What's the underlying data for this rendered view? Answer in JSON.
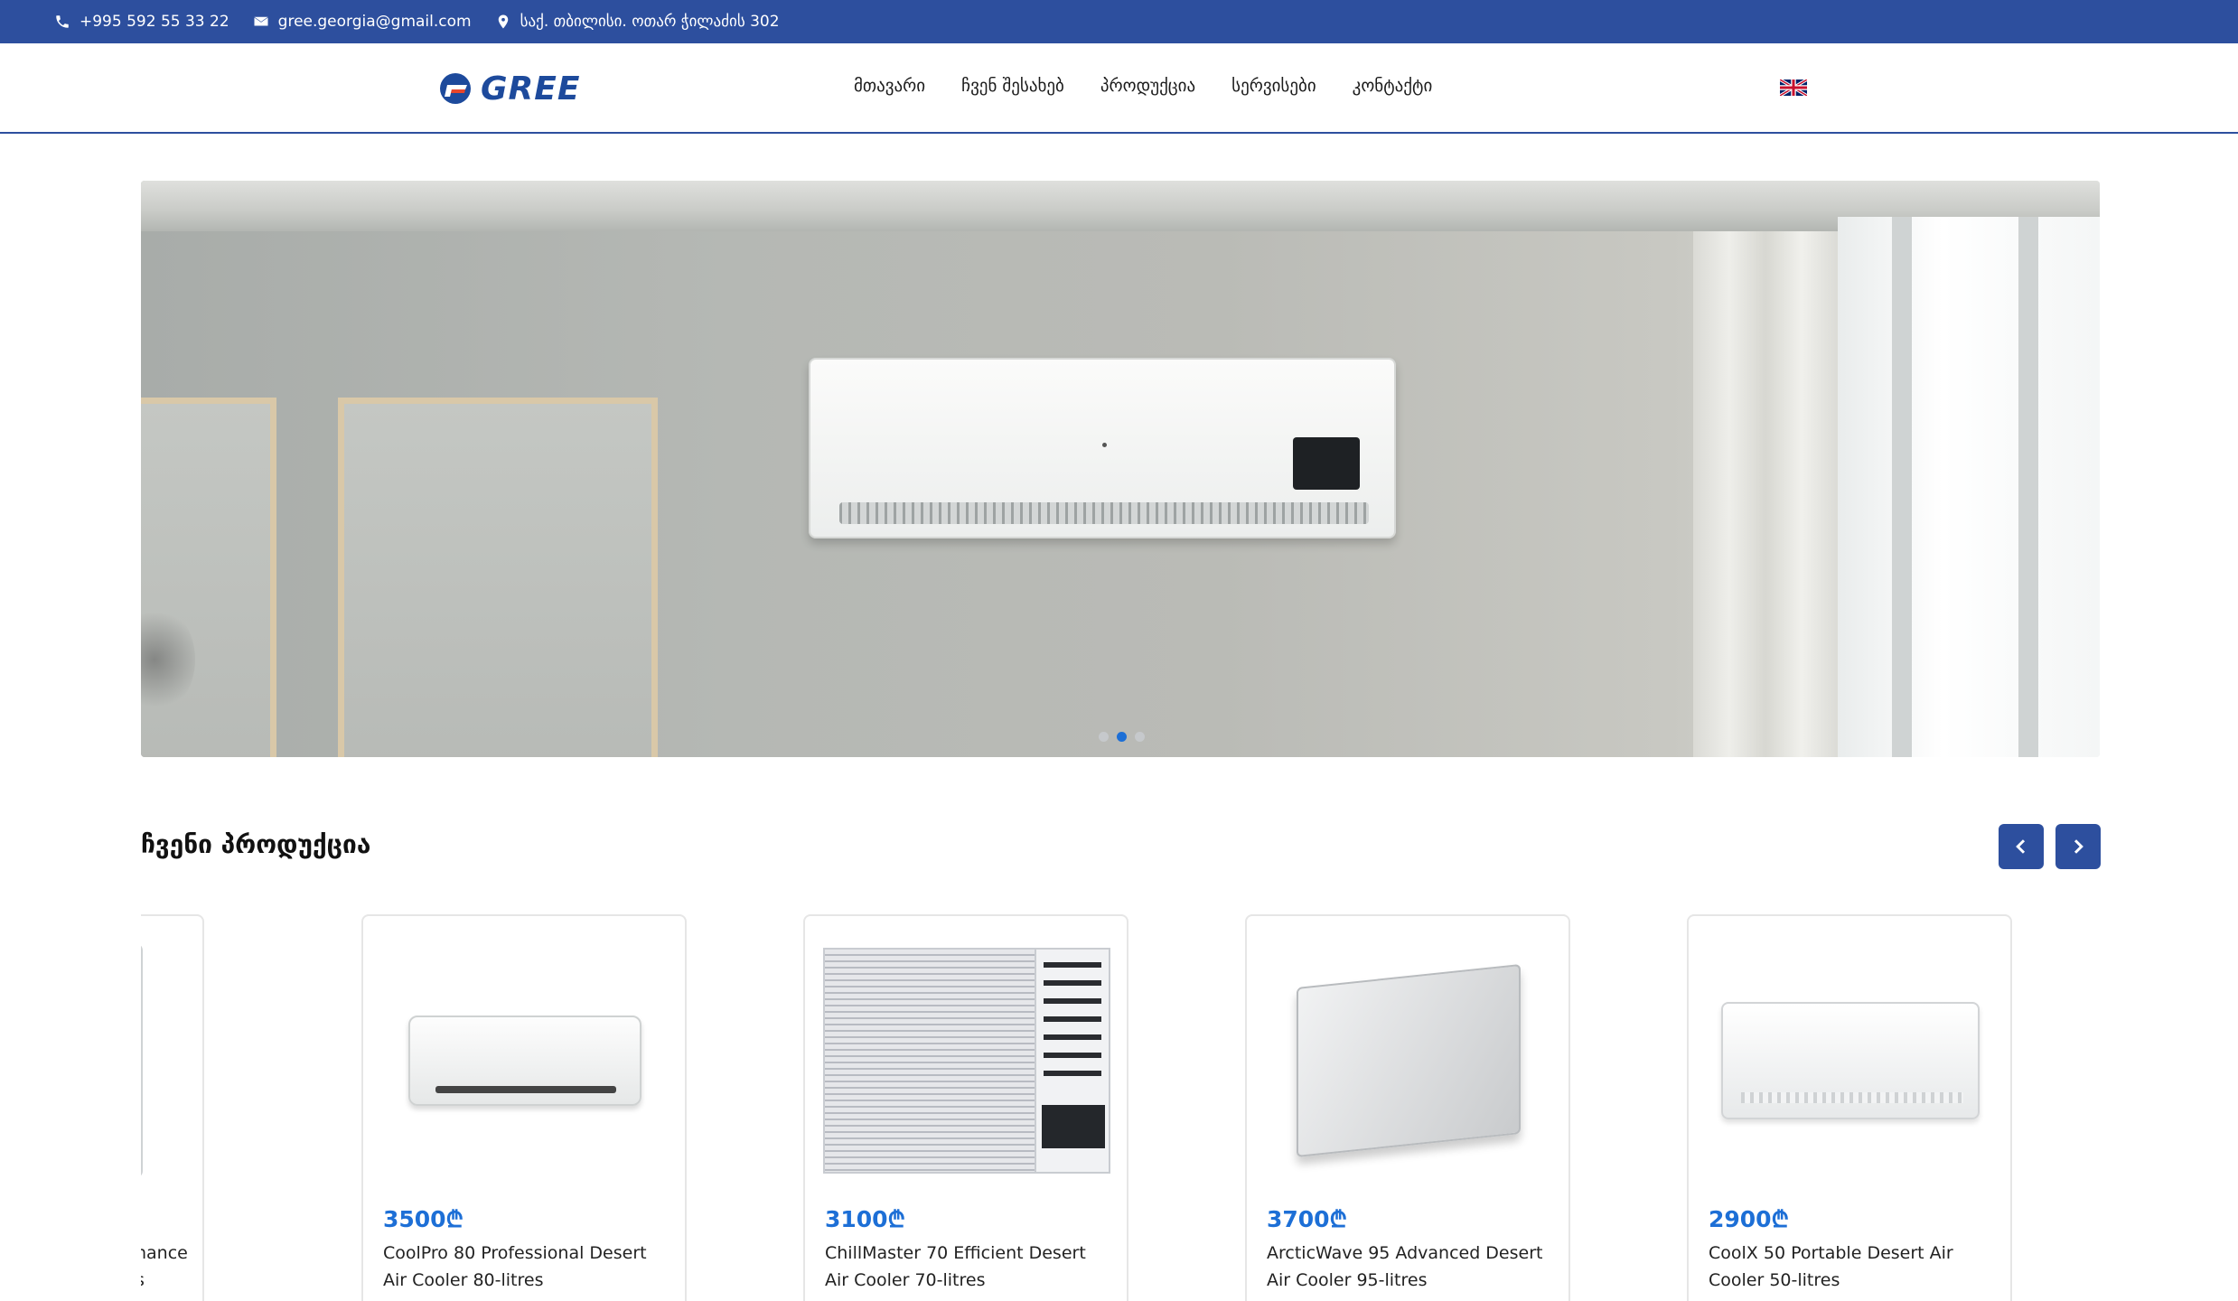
{
  "topbar": {
    "phone": "+995 592 55 33 22",
    "email": "gree.georgia@gmail.com",
    "address": "საქ. თბილისი. ოთარ ჭილაძის 302"
  },
  "brand": {
    "name": "GREE",
    "color": "#1d4a9c"
  },
  "nav": {
    "items": [
      "მთავარი",
      "ჩვენ შესახებ",
      "პროდუქცია",
      "სერვისები",
      "კონტაქტი"
    ],
    "language_icon": "uk-flag-icon"
  },
  "hero": {
    "slides_count": 3,
    "active_slide": 2
  },
  "products": {
    "title": "ჩვენი პროდუქცია",
    "partial_left": {
      "name_fragment_1": "nance",
      "name_fragment_2": "s"
    },
    "items": [
      {
        "price": "3500₾",
        "name": "CoolPro 80 Professional Desert Air Cooler 80-litres"
      },
      {
        "price": "3100₾",
        "name": "ChillMaster 70 Efficient Desert Air Cooler 70-litres"
      },
      {
        "price": "3700₾",
        "name": "ArcticWave 95 Advanced Desert Air Cooler 95-litres"
      },
      {
        "price": "2900₾",
        "name": "CoolX 50 Portable Desert Air Cooler 50-litres"
      }
    ]
  },
  "colors": {
    "primary": "#2d4f9e",
    "price": "#1d6fd6"
  }
}
